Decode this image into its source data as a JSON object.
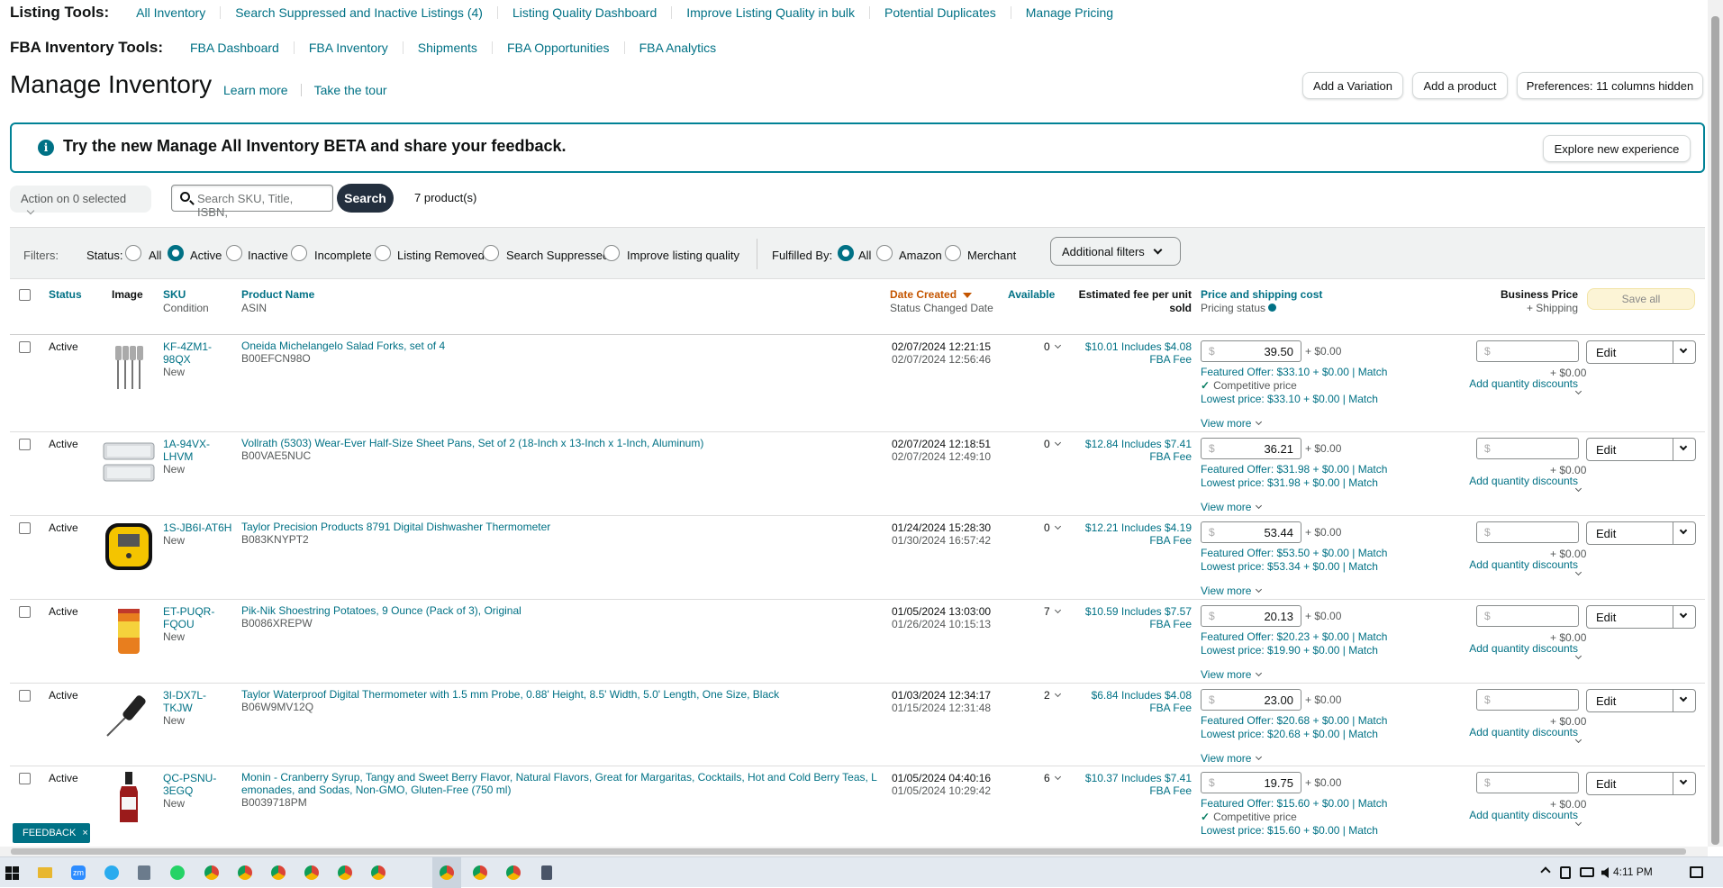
{
  "nav": {
    "listing_title": "Listing Tools:",
    "listing_links": [
      "All Inventory",
      "Search Suppressed and Inactive Listings (4)",
      "Listing Quality Dashboard",
      "Improve Listing Quality in bulk",
      "Potential Duplicates",
      "Manage Pricing"
    ],
    "fba_title": "FBA Inventory Tools:",
    "fba_links": [
      "FBA Dashboard",
      "FBA Inventory",
      "Shipments",
      "FBA Opportunities",
      "FBA Analytics"
    ]
  },
  "header": {
    "title": "Manage Inventory",
    "learn_more": "Learn more",
    "take_tour": "Take the tour",
    "add_variation": "Add a Variation",
    "add_product": "Add a product",
    "preferences": "Preferences: 11 columns hidden"
  },
  "banner": {
    "icon": "i",
    "text": "Try the new Manage All Inventory BETA and share your feedback.",
    "button": "Explore new experience"
  },
  "actions": {
    "action_select": "Action on 0 selected",
    "search_placeholder": "Search SKU, Title, ISBN,",
    "search_button": "Search",
    "count": "7 product(s)"
  },
  "filters": {
    "label": "Filters:",
    "status_label": "Status:",
    "status_options": [
      "All",
      "Active",
      "Inactive",
      "Incomplete",
      "Listing Removed",
      "Search Suppressed",
      "Improve listing quality"
    ],
    "status_selected": "Active",
    "fulfilled_label": "Fulfilled By:",
    "fulfilled_options": [
      "All",
      "Amazon",
      "Merchant"
    ],
    "fulfilled_selected": "All",
    "additional": "Additional filters"
  },
  "table": {
    "headers": {
      "status": "Status",
      "image": "Image",
      "sku": "SKU",
      "sku_sub": "Condition",
      "product": "Product Name",
      "product_sub": "ASIN",
      "date": "Date Created",
      "date_sub": "Status Changed Date",
      "available": "Available",
      "fee1": "Estimated fee per unit",
      "fee2": "sold",
      "price": "Price and shipping cost",
      "price_sub": "Pricing status",
      "business": "Business Price",
      "business_sub": "+ Shipping",
      "save_all": "Save all"
    },
    "rows": [
      {
        "status": "Active",
        "sku1": "KF-4ZM1-",
        "sku2": "98QX",
        "condition": "New",
        "title1": "Oneida Michelangelo Salad Forks, set of 4",
        "title2": "",
        "asin": "B00EFCN98O",
        "date1": "02/07/2024 12:21:15",
        "date2": "02/07/2024 12:56:46",
        "available": "0",
        "fee1": "$10.01 Includes $4.08",
        "fee2": "FBA Fee",
        "price": "39.50",
        "ship": "+ $0.00",
        "featured": "Featured Offer: $33.10 + $0.00",
        "competitive": "Competitive price",
        "lowest": "Lowest price: $33.10 + $0.00",
        "match": "Match",
        "view_more": "View more",
        "bp_ship": "+ $0.00",
        "qty": "Add quantity discounts",
        "edit": "Edit",
        "dollar": "$",
        "img": "forks"
      },
      {
        "status": "Active",
        "sku1": "1A-94VX-",
        "sku2": "LHVM",
        "condition": "New",
        "title1": "Vollrath (5303) Wear-Ever Half-Size Sheet Pans, Set of 2 (18-Inch x 13-Inch x 1-Inch, Aluminum)",
        "title2": "",
        "asin": "B00VAE5NUC",
        "date1": "02/07/2024 12:18:51",
        "date2": "02/07/2024 12:49:10",
        "available": "0",
        "fee1": "$12.84 Includes $7.41",
        "fee2": "FBA Fee",
        "price": "36.21",
        "ship": "+ $0.00",
        "featured": "Featured Offer: $31.98 + $0.00",
        "competitive": "",
        "lowest": "Lowest price: $31.98 + $0.00",
        "match": "Match",
        "view_more": "View more",
        "bp_ship": "+ $0.00",
        "qty": "Add quantity discounts",
        "edit": "Edit",
        "dollar": "$",
        "img": "pans"
      },
      {
        "status": "Active",
        "sku1": "1S-JB6I-AT6H",
        "sku2": "",
        "condition": "New",
        "title1": "Taylor Precision Products 8791 Digital Dishwasher Thermometer",
        "title2": "",
        "asin": "B083KNYPT2",
        "date1": "01/24/2024 15:28:30",
        "date2": "01/30/2024 16:57:42",
        "available": "0",
        "fee1": "$12.21 Includes $4.19",
        "fee2": "FBA Fee",
        "price": "53.44",
        "ship": "+ $0.00",
        "featured": "Featured Offer: $53.50 + $0.00",
        "competitive": "",
        "lowest": "Lowest price: $53.34 + $0.00",
        "match": "Match",
        "view_more": "View more",
        "bp_ship": "+ $0.00",
        "qty": "Add quantity discounts",
        "edit": "Edit",
        "dollar": "$",
        "img": "thermo"
      },
      {
        "status": "Active",
        "sku1": "ET-PUQR-",
        "sku2": "FQOU",
        "condition": "New",
        "title1": "Pik-Nik Shoestring Potatoes, 9 Ounce (Pack of 3), Original",
        "title2": "",
        "asin": "B0086XREPW",
        "date1": "01/05/2024 13:03:00",
        "date2": "01/26/2024 10:15:13",
        "available": "7",
        "fee1": "$10.59 Includes $7.57",
        "fee2": "FBA Fee",
        "price": "20.13",
        "ship": "+ $0.00",
        "featured": "Featured Offer: $20.23 + $0.00",
        "competitive": "",
        "lowest": "Lowest price: $19.90 + $0.00",
        "match": "Match",
        "view_more": "View more",
        "bp_ship": "+ $0.00",
        "qty": "Add quantity discounts",
        "edit": "Edit",
        "dollar": "$",
        "img": "can"
      },
      {
        "status": "Active",
        "sku1": "3I-DX7L-",
        "sku2": "TKJW",
        "condition": "New",
        "title1": "Taylor Waterproof Digital Thermometer with 1.5 mm Probe, 0.88' Height, 8.5' Width, 5.0' Length, One Size, Black",
        "title2": "",
        "asin": "B06W9MV12Q",
        "date1": "01/03/2024 12:34:17",
        "date2": "01/15/2024 12:31:48",
        "available": "2",
        "fee1": "$6.84 Includes $4.08",
        "fee2": "FBA Fee",
        "price": "23.00",
        "ship": "+ $0.00",
        "featured": "Featured Offer: $20.68 + $0.00",
        "competitive": "",
        "lowest": "Lowest price: $20.68 + $0.00",
        "match": "Match",
        "view_more": "View more",
        "bp_ship": "+ $0.00",
        "qty": "Add quantity discounts",
        "edit": "Edit",
        "dollar": "$",
        "img": "probe"
      },
      {
        "status": "Active",
        "sku1": "QC-PSNU-",
        "sku2": "3EGQ",
        "condition": "New",
        "title1": "Monin - Cranberry Syrup, Tangy and Sweet Berry Flavor, Natural Flavors, Great for Margaritas, Cocktails, Hot and Cold Berry Teas, L",
        "title2": "emonades, and Sodas, Non-GMO, Gluten-Free (750 ml)",
        "asin": "B0039718PM",
        "date1": "01/05/2024 04:40:16",
        "date2": "01/05/2024 10:29:42",
        "available": "6",
        "fee1": "$10.37 Includes $7.41",
        "fee2": "FBA Fee",
        "price": "19.75",
        "ship": "+ $0.00",
        "featured": "Featured Offer: $15.60 + $0.00",
        "competitive": "Competitive price",
        "lowest": "Lowest price: $15.60 + $0.00",
        "match": "Match",
        "view_more": "View more",
        "bp_ship": "+ $0.00",
        "qty": "Add quantity discounts",
        "edit": "Edit",
        "dollar": "$",
        "img": "bottle"
      }
    ]
  },
  "feedback": "FEEDBACK",
  "feedback_close": "×",
  "taskbar": {
    "time": "4:11 PM",
    "zm_label": "zm"
  },
  "colors": {
    "link": "#007185",
    "accent_orange": "#C45500",
    "dark_button": "#232F3E",
    "banner_border": "#008296"
  }
}
